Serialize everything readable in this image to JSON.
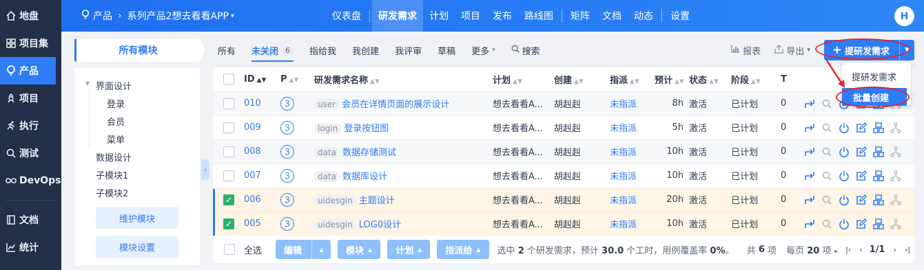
{
  "leftnav": {
    "items": [
      {
        "label": "地盘",
        "icon": "home-icon"
      },
      {
        "label": "项目集",
        "icon": "grid-icon"
      },
      {
        "label": "产品",
        "icon": "bulb-icon",
        "active": true
      },
      {
        "label": "项目",
        "icon": "rocket-icon"
      },
      {
        "label": "执行",
        "icon": "run-icon"
      },
      {
        "label": "测试",
        "icon": "search-icon"
      },
      {
        "label": "DevOps",
        "icon": "infinity-icon"
      },
      {
        "label": "文档",
        "icon": "book-icon"
      },
      {
        "label": "统计",
        "icon": "chart-icon"
      }
    ]
  },
  "header": {
    "product": "产品",
    "product_name": "系列产品2想去看看APP",
    "nav": [
      "仪表盘",
      "研发需求",
      "计划",
      "项目",
      "发布",
      "路线图",
      "矩阵",
      "文档",
      "动态",
      "设置"
    ],
    "active_nav": "研发需求",
    "avatar": "H"
  },
  "modules": {
    "title": "所有模块",
    "tree": [
      {
        "label": "界面设计",
        "level": 0
      },
      {
        "label": "登录",
        "level": 1
      },
      {
        "label": "会员",
        "level": 1
      },
      {
        "label": "菜单",
        "level": 1
      },
      {
        "label": "数据设计",
        "level": 0
      },
      {
        "label": "子模块1",
        "level": 0
      },
      {
        "label": "子模块2",
        "level": 0
      }
    ],
    "maintain_btn": "维护模块",
    "settings_btn": "模块设置"
  },
  "toolbar": {
    "tabs": [
      "所有",
      "未关闭",
      "指给我",
      "我创建",
      "我评审",
      "草稿",
      "更多"
    ],
    "open_count": "6",
    "search": "搜索",
    "report": "报表",
    "export": "导出",
    "create_btn": "提研发需求"
  },
  "dropdown": {
    "items": [
      "提研发需求",
      "批量创建"
    ]
  },
  "table": {
    "headers": [
      "ID",
      "P",
      "研发需求名称",
      "计划",
      "创建",
      "指派",
      "预计",
      "状态",
      "阶段",
      "T"
    ],
    "rows": [
      {
        "id": "010",
        "pri": "3",
        "tag": "user",
        "title": "会员在详情页面的展示设计",
        "plan": "想去看看A...",
        "creator": "胡赳赳",
        "assignee": "未指派",
        "estimate": "8h",
        "status": "激活",
        "stage": "已计划",
        "t": "0",
        "checked": false
      },
      {
        "id": "009",
        "pri": "3",
        "tag": "login",
        "title": "登录按钮图",
        "plan": "想去看看A...",
        "creator": "胡赳赳",
        "assignee": "未指派",
        "estimate": "5h",
        "status": "激活",
        "stage": "已计划",
        "t": "0",
        "checked": false
      },
      {
        "id": "008",
        "pri": "3",
        "tag": "data",
        "title": "数据存储测试",
        "plan": "想去看看A...",
        "creator": "胡赳赳",
        "assignee": "未指派",
        "estimate": "10h",
        "status": "激活",
        "stage": "已计划",
        "t": "0",
        "checked": false
      },
      {
        "id": "007",
        "pri": "3",
        "tag": "data",
        "title": "数据库设计",
        "plan": "想去看看A...",
        "creator": "胡赳赳",
        "assignee": "未指派",
        "estimate": "10h",
        "status": "激活",
        "stage": "已计划",
        "t": "0",
        "checked": false
      },
      {
        "id": "006",
        "pri": "3",
        "tag": "uidesgin",
        "title": "主题设计",
        "plan": "想去看看A...",
        "creator": "胡赳赳",
        "assignee": "未指派",
        "estimate": "20h",
        "status": "激活",
        "stage": "已计划",
        "t": "0",
        "checked": true
      },
      {
        "id": "005",
        "pri": "3",
        "tag": "uidesgin",
        "title": "LOG0设计",
        "plan": "想去看看A...",
        "creator": "胡赳赳",
        "assignee": "未指派",
        "estimate": "10h",
        "status": "激活",
        "stage": "已计划",
        "t": "0",
        "checked": true
      }
    ]
  },
  "footer": {
    "select_all": "全选",
    "edit": "编辑",
    "module": "模块",
    "plan": "计划",
    "assign": "指派给",
    "summary_pre": "选中",
    "summary_count": "2",
    "summary_mid": "个研发需求，预计",
    "summary_hours": "30.0",
    "summary_post": "个工时，用例覆盖率",
    "summary_cov": "0%",
    "summary_end": "。",
    "total_pre": "共",
    "total": "6",
    "total_post": "项",
    "per_page_pre": "每页",
    "per_page": "20",
    "per_page_post": "项",
    "page": "1/1"
  },
  "colors": {
    "primary": "#2e7cf6",
    "nav_bg": "#243048",
    "highlight": "#e3262d"
  }
}
